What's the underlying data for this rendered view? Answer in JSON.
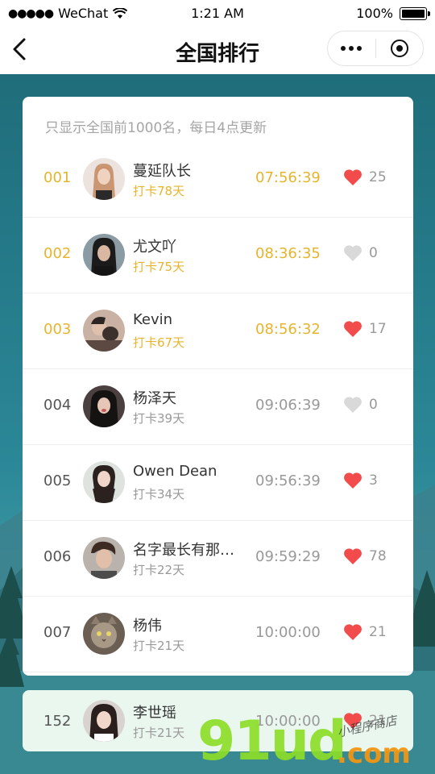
{
  "status_bar": {
    "carrier": "WeChat",
    "time": "1:21 AM",
    "battery": "100%"
  },
  "nav": {
    "title": "全国排行"
  },
  "notice": "只显示全国前1000名，每日4点更新",
  "colors": {
    "gold": "#e6b52d",
    "heart_red": "#f14b4b",
    "heart_grey": "#d9d9d9"
  },
  "rankings": [
    {
      "rank": "001",
      "name": "蔓延队长",
      "checkin": "打卡78天",
      "time": "07:56:39",
      "liked": true,
      "likes": "25"
    },
    {
      "rank": "002",
      "name": "尤文吖",
      "checkin": "打卡75天",
      "time": "08:36:35",
      "liked": false,
      "likes": "0"
    },
    {
      "rank": "003",
      "name": "Kevin",
      "checkin": "打卡67天",
      "time": "08:56:32",
      "liked": true,
      "likes": "17"
    },
    {
      "rank": "004",
      "name": "杨泽天",
      "checkin": "打卡39天",
      "time": "09:06:39",
      "liked": false,
      "likes": "0"
    },
    {
      "rank": "005",
      "name": "Owen Dean",
      "checkin": "打卡34天",
      "time": "09:56:39",
      "liked": true,
      "likes": "3"
    },
    {
      "rank": "006",
      "name": "名字最长有那…",
      "checkin": "打卡22天",
      "time": "09:59:29",
      "liked": true,
      "likes": "78"
    },
    {
      "rank": "007",
      "name": "杨伟",
      "checkin": "打卡21天",
      "time": "10:00:00",
      "liked": true,
      "likes": "21"
    }
  ],
  "my_rank": {
    "rank": "152",
    "name": "李世瑶",
    "checkin": "打卡21天",
    "time": "10:00:00",
    "liked": true,
    "likes": "21"
  },
  "watermark": {
    "brand": "91ud",
    "suffix": ".com",
    "tag": "小程序商店"
  }
}
